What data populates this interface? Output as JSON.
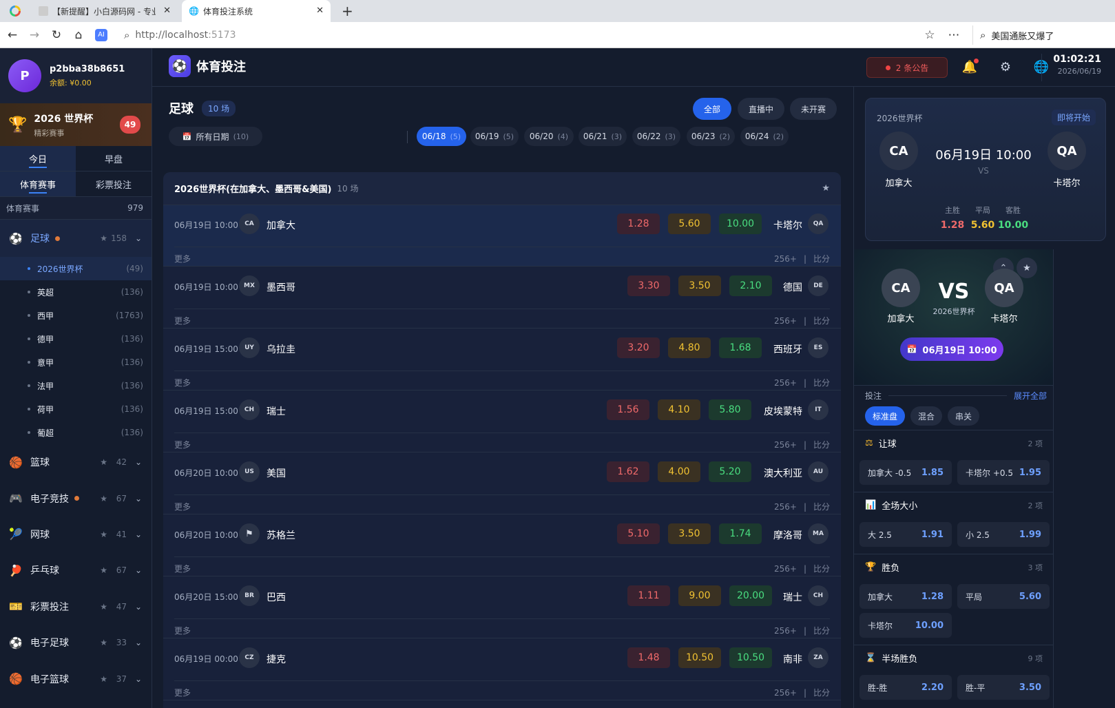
{
  "browser": {
    "tabs": [
      {
        "title": "【新提醒】小白源码网 - 专业"
      },
      {
        "title": "体育投注系统"
      }
    ],
    "url_host": "http://localhost",
    "url_port": ":5173",
    "search_text": "美国通胀又爆了"
  },
  "user": {
    "initial": "P",
    "name": "p2bba38b8651",
    "balance": "余额: ¥0.00"
  },
  "worldcup_banner": {
    "title": "2026 世界杯",
    "subtitle": "精彩赛事",
    "count": "49"
  },
  "sidebar": {
    "day_tabs": [
      "今日",
      "早盘"
    ],
    "type_tabs": [
      "体育赛事",
      "彩票投注"
    ],
    "all_label": "体育赛事",
    "all_count": "979",
    "football": {
      "label": "足球",
      "count": "158"
    },
    "leagues": [
      {
        "name": "2026世界杯",
        "count": "(49)"
      },
      {
        "name": "英超",
        "count": "(136)"
      },
      {
        "name": "西甲",
        "count": "(1763)"
      },
      {
        "name": "德甲",
        "count": "(136)"
      },
      {
        "name": "意甲",
        "count": "(136)"
      },
      {
        "name": "法甲",
        "count": "(136)"
      },
      {
        "name": "荷甲",
        "count": "(136)"
      },
      {
        "name": "葡超",
        "count": "(136)"
      }
    ],
    "sports": [
      {
        "label": "篮球",
        "count": "42",
        "icon": "basketball-icon"
      },
      {
        "label": "电子竞技",
        "count": "67",
        "icon": "gamepad-icon"
      },
      {
        "label": "网球",
        "count": "41",
        "icon": "tennis-icon"
      },
      {
        "label": "乒乓球",
        "count": "67",
        "icon": "pingpong-icon"
      },
      {
        "label": "彩票投注",
        "count": "47",
        "icon": "ticket-icon"
      },
      {
        "label": "电子足球",
        "count": "33",
        "icon": "soccer-ball-icon"
      },
      {
        "label": "电子篮球",
        "count": "37",
        "icon": "basketball-icon"
      }
    ]
  },
  "header": {
    "title": "体育投注",
    "notice": "2 条公告",
    "time": "01:02:21",
    "date": "2026/06/19"
  },
  "main": {
    "title": "足球",
    "count": "10 场",
    "filters": [
      "全部",
      "直播中",
      "未开赛"
    ],
    "all_dates": {
      "label": "所有日期",
      "count": "(10)"
    },
    "dates": [
      {
        "label": "06/18",
        "count": "(5)"
      },
      {
        "label": "06/19",
        "count": "(5)"
      },
      {
        "label": "06/20",
        "count": "(4)"
      },
      {
        "label": "06/21",
        "count": "(3)"
      },
      {
        "label": "06/22",
        "count": "(3)"
      },
      {
        "label": "06/23",
        "count": "(2)"
      },
      {
        "label": "06/24",
        "count": "(2)"
      }
    ],
    "league_title": "2026世界杯(在加拿大、墨西哥&美国)",
    "league_count": "10 场",
    "more_label": "更多",
    "more_count": "256+",
    "more_sep": "|",
    "score_label": "比分",
    "matches": [
      {
        "time": "06月19日 10:00",
        "home_code": "CA",
        "home": "加拿大",
        "o1": "1.28",
        "ox": "5.60",
        "o2": "10.00",
        "away": "卡塔尔",
        "away_code": "QA"
      },
      {
        "time": "06月19日 10:00",
        "home_code": "MX",
        "home": "墨西哥",
        "o1": "3.30",
        "ox": "3.50",
        "o2": "2.10",
        "away": "德国",
        "away_code": "DE"
      },
      {
        "time": "06月19日 15:00",
        "home_code": "UY",
        "home": "乌拉圭",
        "o1": "3.20",
        "ox": "4.80",
        "o2": "1.68",
        "away": "西班牙",
        "away_code": "ES"
      },
      {
        "time": "06月19日 15:00",
        "home_code": "CH",
        "home": "瑞士",
        "o1": "1.56",
        "ox": "4.10",
        "o2": "5.80",
        "away": "皮埃蒙特",
        "away_code": "IT"
      },
      {
        "time": "06月20日 10:00",
        "home_code": "US",
        "home": "美国",
        "o1": "1.62",
        "ox": "4.00",
        "o2": "5.20",
        "away": "澳大利亚",
        "away_code": "AU"
      },
      {
        "time": "06月20日 10:00",
        "home_code": "",
        "home": "苏格兰",
        "o1": "5.10",
        "ox": "3.50",
        "o2": "1.74",
        "away": "摩洛哥",
        "away_code": "MA"
      },
      {
        "time": "06月20日 15:00",
        "home_code": "BR",
        "home": "巴西",
        "o1": "1.11",
        "ox": "9.00",
        "o2": "20.00",
        "away": "瑞士",
        "away_code": "CH"
      },
      {
        "time": "06月19日 00:00",
        "home_code": "CZ",
        "home": "捷克",
        "o1": "1.48",
        "ox": "10.50",
        "o2": "10.50",
        "away": "南非",
        "away_code": "ZA"
      }
    ]
  },
  "featured": {
    "league": "2026世界杯",
    "status": "即将开始",
    "home_code": "CA",
    "home": "加拿大",
    "away_code": "QA",
    "away": "卡塔尔",
    "time": "06月19日 10:00",
    "vs": "VS",
    "labels": [
      "主胜",
      "平局",
      "客胜"
    ],
    "odds": [
      "1.28",
      "5.60",
      "10.00"
    ]
  },
  "detail": {
    "home_code": "CA",
    "home": "加拿大",
    "away_code": "QA",
    "away": "卡塔尔",
    "vs": "VS",
    "league": "2026世界杯",
    "date": "06月19日 10:00",
    "bet_label": "投注",
    "expand": "展开全部",
    "bet_types": [
      "标准盘",
      "混合",
      "串关"
    ],
    "markets": [
      {
        "title": "让球",
        "count": "2 项",
        "icon": "scale-icon",
        "options": [
          {
            "label": "加拿大 -0.5",
            "odd": "1.85"
          },
          {
            "label": "卡塔尔 +0.5",
            "odd": "1.95"
          }
        ]
      },
      {
        "title": "全场大小",
        "count": "2 项",
        "icon": "bar-chart-icon",
        "options": [
          {
            "label": "大 2.5",
            "odd": "1.91"
          },
          {
            "label": "小 2.5",
            "odd": "1.99"
          }
        ]
      },
      {
        "title": "胜负",
        "count": "3 项",
        "icon": "trophy-icon",
        "options": [
          {
            "label": "加拿大",
            "odd": "1.28"
          },
          {
            "label": "平局",
            "odd": "5.60"
          },
          {
            "label": "卡塔尔",
            "odd": "10.00"
          }
        ]
      },
      {
        "title": "半场胜负",
        "count": "9 项",
        "icon": "hourglass-icon",
        "options": [
          {
            "label": "胜-胜",
            "odd": "2.20"
          },
          {
            "label": "胜-平",
            "odd": "3.50"
          }
        ]
      }
    ]
  }
}
